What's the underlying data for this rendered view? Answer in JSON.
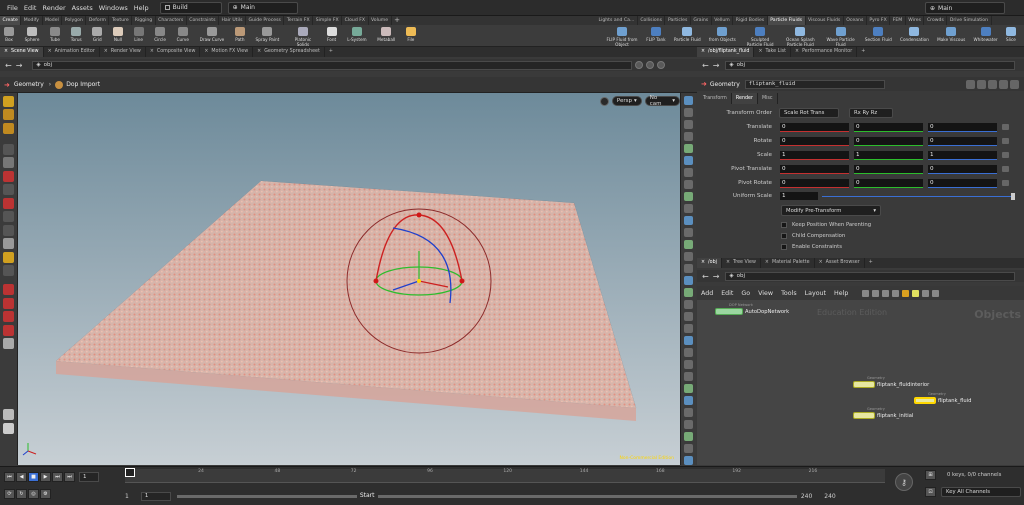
{
  "menubar": {
    "items": [
      "File",
      "Edit",
      "Render",
      "Assets",
      "Windows",
      "Help"
    ],
    "desktop": "Build",
    "context": "Main",
    "right_context": "Main"
  },
  "shelf_left_tabs": [
    "Create",
    "Modify",
    "Model",
    "Polygon",
    "Deform",
    "Texture",
    "Rigging",
    "Characters",
    "Constraints",
    "Hair Utils",
    "Guide Process",
    "Terrain FX",
    "Simple FX",
    "Cloud FX",
    "Volume"
  ],
  "shelf_right_tabs": [
    "Lights and Ca...",
    "Collisions",
    "Particles",
    "Grains",
    "Vellum",
    "Rigid Bodies",
    "Particle Fluids",
    "Viscous Fluids",
    "Oceans",
    "Pyro FX",
    "FEM",
    "Wires",
    "Crowds",
    "Drive Simulation"
  ],
  "shelf_left_tools": [
    "Box",
    "Sphere",
    "Tube",
    "Torus",
    "Grid",
    "Null",
    "Line",
    "Circle",
    "Curve",
    "Draw Curve",
    "Path",
    "Spray Paint",
    "Platonic Solids",
    "Font",
    "L-System",
    "Metaball",
    "File"
  ],
  "shelf_right_tools": [
    "FLIP Fluid from Object",
    "FLIP Tank",
    "Particle Fluid",
    "from Objects",
    "Sculpted Particle Fluid",
    "Ocean Splash Particle Fluid",
    "Wave Particle Fluid",
    "Section Fluid",
    "Condensation",
    "Make Viscous",
    "Whitewater",
    "Slice"
  ],
  "left_pane_tabs": [
    "Scene View",
    "Animation Editor",
    "Render View",
    "Composite View",
    "Motion FX View",
    "Geometry Spreadsheet"
  ],
  "right_top_tabs": [
    "/obj/fliptank_fluid",
    "Take List",
    "Performance Monitor"
  ],
  "left_path": "obj",
  "right_path": "obj",
  "viewport": {
    "state_label": "Geometry",
    "network_label": "Dop Import",
    "persp": "Persp",
    "camera": "No cam",
    "hint": "Non-Commercial Edition"
  },
  "params": {
    "node_type": "Geometry",
    "node_name": "fliptank_fluid",
    "tabs": [
      "Transform",
      "Render",
      "Misc"
    ],
    "transform_order_label": "Transform Order",
    "transform_order": "Scale Rot Trans",
    "rot_order": "Rx Ry Rz",
    "rows": [
      {
        "label": "Translate",
        "values": [
          "0",
          "0",
          "0"
        ]
      },
      {
        "label": "Rotate",
        "values": [
          "0",
          "0",
          "0"
        ]
      },
      {
        "label": "Scale",
        "values": [
          "1",
          "1",
          "1"
        ]
      },
      {
        "label": "Pivot Translate",
        "values": [
          "0",
          "0",
          "0"
        ]
      },
      {
        "label": "Pivot Rotate",
        "values": [
          "0",
          "0",
          "0"
        ]
      }
    ],
    "uniform_scale_label": "Uniform Scale",
    "uniform_scale": "1",
    "modify_pretransform": "Modify Pre-Transform",
    "checkboxes": [
      "Keep Position When Parenting",
      "Child Compensation",
      "Enable Constraints"
    ]
  },
  "net_tabs": [
    "/obj",
    "Tree View",
    "Material Palette",
    "Asset Browser"
  ],
  "net_menu": [
    "Add",
    "Edit",
    "Go",
    "View",
    "Tools",
    "Layout",
    "Help"
  ],
  "net": {
    "watermark_edition": "Education Edition",
    "watermark_context": "Objects",
    "nodes": [
      {
        "name": "AutoDopNetwork",
        "sub": "DOP Network"
      },
      {
        "name": "fliptank_fluidinterior",
        "sub": "Geometry"
      },
      {
        "name": "fliptank_fluid",
        "sub": "Geometry"
      },
      {
        "name": "fliptank_initial",
        "sub": "Geometry"
      }
    ]
  },
  "timeline": {
    "frame": "1",
    "ticks": [
      "24",
      "48",
      "72",
      "96",
      "120",
      "144",
      "168",
      "192",
      "216"
    ],
    "start": "1",
    "start2": "1",
    "start_label": "Start",
    "end": "240",
    "end2": "240",
    "keys_info": "0 keys, 0/0 channels",
    "key_all": "Key All Channels",
    "icons": [
      "prev-key-icon",
      "play-back-icon",
      "stop-icon",
      "play-icon",
      "next-key-icon",
      "end-icon"
    ]
  },
  "colors": {
    "grid_top": "#6d8a9a",
    "grid_bottom": "#c7cfd4",
    "particles": "#e8a08e",
    "node_fill": "#e8e8a0",
    "accent": "#ffd700"
  }
}
